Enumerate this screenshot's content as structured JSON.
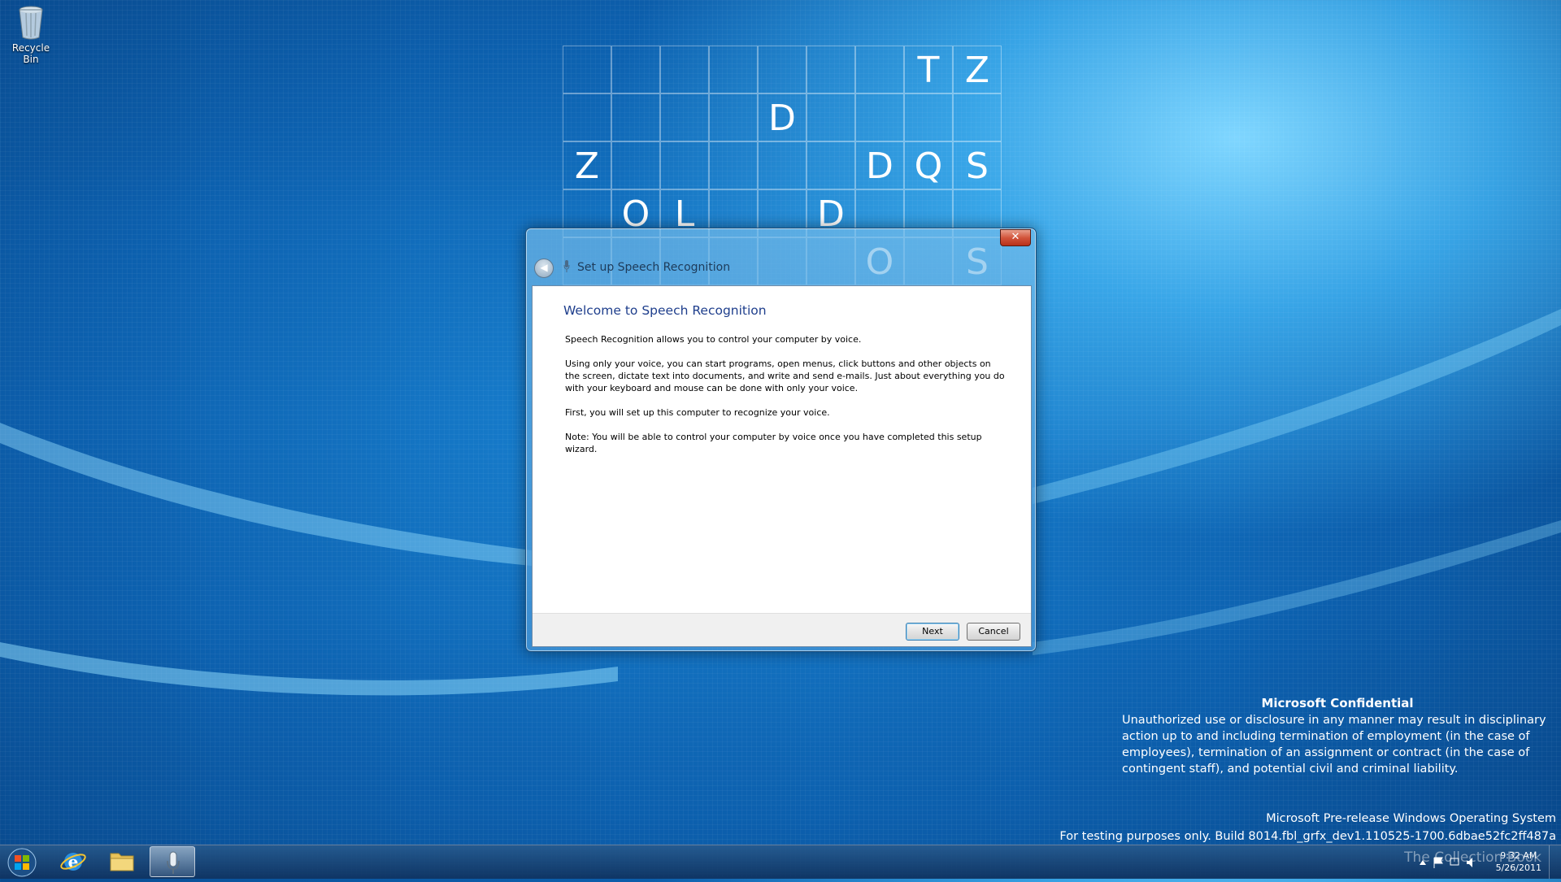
{
  "desktop": {
    "recycle_bin_label": "Recycle Bin",
    "letter_grid": [
      {
        "row": 0,
        "col": 7,
        "letter": "T"
      },
      {
        "row": 0,
        "col": 8,
        "letter": "Z"
      },
      {
        "row": 1,
        "col": 4,
        "letter": "D"
      },
      {
        "row": 2,
        "col": 0,
        "letter": "Z"
      },
      {
        "row": 2,
        "col": 6,
        "letter": "D"
      },
      {
        "row": 2,
        "col": 7,
        "letter": "Q"
      },
      {
        "row": 2,
        "col": 8,
        "letter": "S"
      },
      {
        "row": 3,
        "col": 1,
        "letter": "O"
      },
      {
        "row": 3,
        "col": 2,
        "letter": "L"
      },
      {
        "row": 3,
        "col": 5,
        "letter": "D"
      },
      {
        "row": 4,
        "col": 6,
        "letter": "O"
      },
      {
        "row": 4,
        "col": 8,
        "letter": "S"
      }
    ],
    "grid_rows": 5,
    "grid_cols": 9
  },
  "dialog": {
    "title": "Set up Speech Recognition",
    "close_glyph": "✕",
    "back_glyph": "◀",
    "heading": "Welcome to Speech Recognition",
    "paragraphs": [
      "Speech Recognition allows you to control your computer by voice.",
      "Using only your voice, you can start programs, open menus, click buttons and other objects on the screen, dictate text into documents, and write and send e-mails. Just about everything you do with your keyboard and mouse can be done with only your voice.",
      "First, you will set up this computer to recognize your voice.",
      "Note: You will be able to control your computer by voice once you have completed this setup wizard."
    ],
    "next_label": "Next",
    "cancel_label": "Cancel"
  },
  "confidential": {
    "title": "Microsoft Confidential",
    "text": "Unauthorized use or disclosure in any manner may result in disciplinary action up to and including termination of employment (in the case of employees), termination of an assignment or contract (in the case of contingent staff), and potential civil and criminal liability."
  },
  "prerelease": {
    "line1": "Microsoft Pre-release Windows Operating System",
    "line2": "For testing purposes only. Build 8014.fbl_grfx_dev1.110525-1700.6dbae52fc2ff487a"
  },
  "taskbar": {
    "time": "9:32 AM",
    "date": "5/26/2011",
    "watermark": "The Collection Book"
  },
  "colors": {
    "accent": "#1e3e8c",
    "close_red": "#d2553c"
  }
}
